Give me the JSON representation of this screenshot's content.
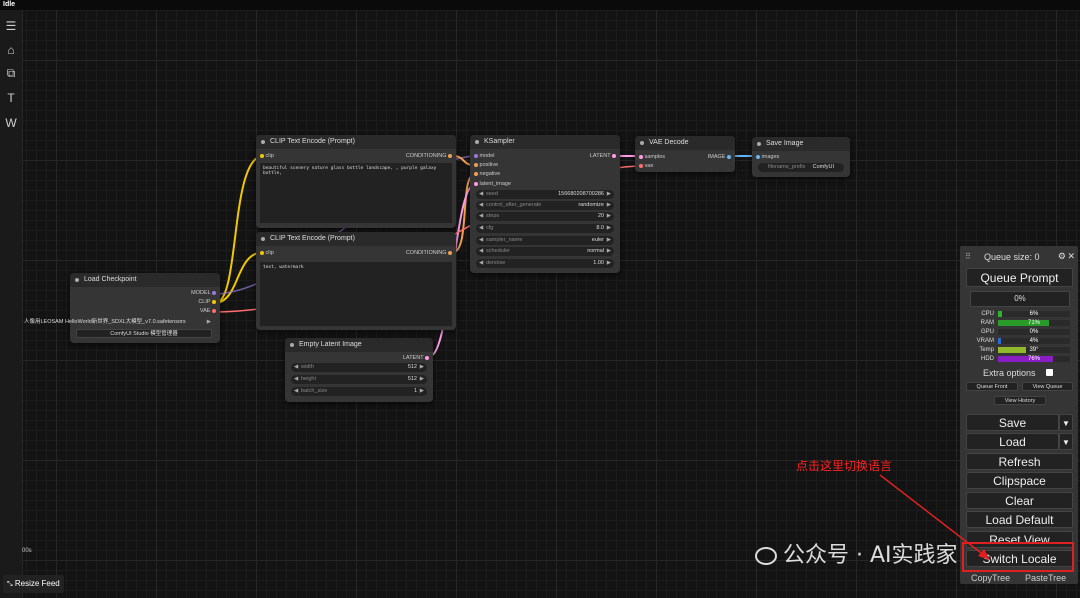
{
  "window": {
    "title": "Idle"
  },
  "sidebar": {
    "items": [
      {
        "icon": "menu-icon",
        "glyph": "☰"
      },
      {
        "icon": "home-icon",
        "glyph": "⌂"
      },
      {
        "icon": "layers-icon",
        "glyph": "⧉"
      },
      {
        "icon": "text-icon",
        "glyph": "T"
      },
      {
        "icon": "w-icon",
        "glyph": "W"
      }
    ]
  },
  "nodes": {
    "clip_pos": {
      "title": "CLIP Text Encode (Prompt)",
      "input": "clip",
      "output": "CONDITIONING",
      "text": "beautiful scenery nature glass bottle landscape, , purple galaxy bottle,"
    },
    "clip_neg": {
      "title": "CLIP Text Encode (Prompt)",
      "input": "clip",
      "output": "CONDITIONING",
      "text": "text, watermark"
    },
    "load_checkpoint": {
      "title": "Load Checkpoint",
      "outputs": [
        "MODEL",
        "CLIP",
        "VAE"
      ],
      "ckpt_name": "人像用LEOSAM HelloWorld新世界_SDXL大模型_v7.0.safetensors",
      "studio": "ComfyUI Studio 模型管理器"
    },
    "ksampler": {
      "title": "KSampler",
      "inputs": [
        "model",
        "positive",
        "negative",
        "latent_image"
      ],
      "output": "LATENT",
      "widgets": [
        {
          "label": "seed",
          "value": "156680208700286"
        },
        {
          "label": "control_after_generate",
          "value": "randomize"
        },
        {
          "label": "steps",
          "value": "20"
        },
        {
          "label": "cfg",
          "value": "8.0"
        },
        {
          "label": "sampler_name",
          "value": "euler"
        },
        {
          "label": "scheduler",
          "value": "normal"
        },
        {
          "label": "denoise",
          "value": "1.00"
        }
      ]
    },
    "vae_decode": {
      "title": "VAE Decode",
      "inputs": [
        "samples",
        "vae"
      ],
      "output": "IMAGE"
    },
    "save_image": {
      "title": "Save Image",
      "input": "images",
      "prefix_label": "filename_prefix",
      "prefix_value": "ComfyUI"
    },
    "empty_latent": {
      "title": "Empty Latent Image",
      "output": "LATENT",
      "widgets": [
        {
          "label": "width",
          "value": "512"
        },
        {
          "label": "height",
          "value": "512"
        },
        {
          "label": "batch_size",
          "value": "1"
        }
      ]
    }
  },
  "queue_panel": {
    "queue_size": "Queue size: 0",
    "queue_prompt": "Queue Prompt",
    "progress": "0%",
    "stats": [
      {
        "label": "CPU",
        "value": "6%",
        "level": 0.06,
        "color": "#2ab52a"
      },
      {
        "label": "RAM",
        "value": "71%",
        "level": 0.71,
        "color": "#2a9a2a"
      },
      {
        "label": "GPU",
        "value": "0%",
        "level": 0.0,
        "color": "#2a9a2a"
      },
      {
        "label": "VRAM",
        "value": "4%",
        "level": 0.04,
        "color": "#2a6bd6"
      },
      {
        "label": "Temp",
        "value": "39°",
        "level": 0.39,
        "color": "#8fb82a"
      },
      {
        "label": "HDD",
        "value": "76%",
        "level": 0.76,
        "color": "#8a1ec4"
      }
    ],
    "extra_options": "Extra options",
    "queue_front": "Queue Front",
    "view_queue": "View Queue",
    "view_history": "View History",
    "buttons": [
      "Save",
      "Load",
      "Refresh",
      "Clipspace",
      "Clear",
      "Load Default",
      "Reset View",
      "Switch Locale"
    ],
    "copy_tree": "CopyTree",
    "paste_tree": "PasteTree"
  },
  "annotation": {
    "text": "点击这里切换语言"
  },
  "watermark": {
    "text": "公众号 · AI实践家"
  },
  "bottom": {
    "resize_feed": "Resize Feed",
    "timestamp": "00s"
  }
}
